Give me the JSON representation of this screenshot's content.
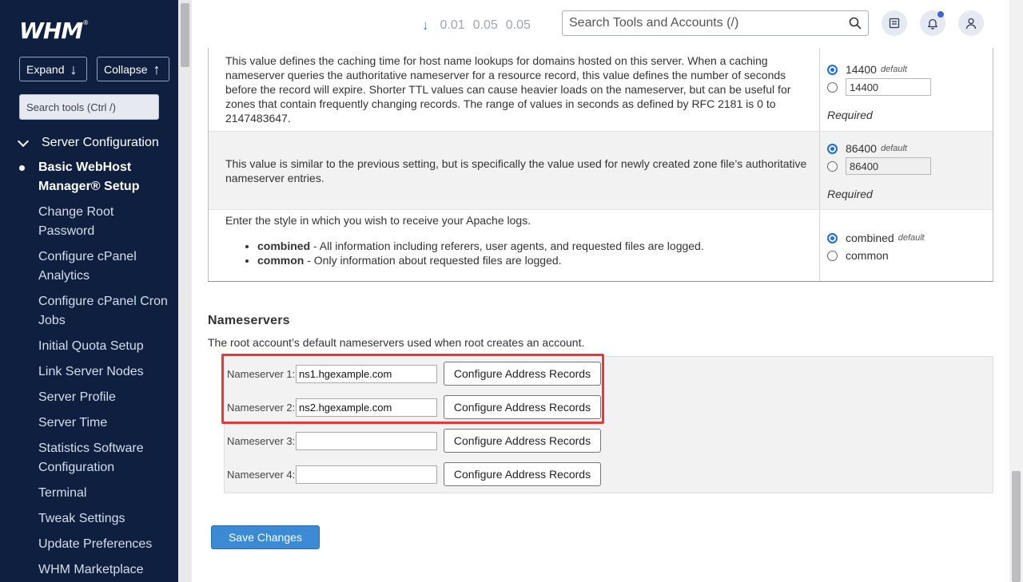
{
  "sidebar": {
    "logo": "WHM",
    "logo_mark": "®",
    "expand_label": "Expand",
    "collapse_label": "Collapse",
    "search_placeholder": "Search tools (Ctrl /)",
    "section": "Server Configuration",
    "items": [
      {
        "label": "Basic WebHost Manager® Setup",
        "active": true
      },
      {
        "label": "Change Root Password"
      },
      {
        "label": "Configure cPanel Analytics"
      },
      {
        "label": "Configure cPanel Cron Jobs"
      },
      {
        "label": "Initial Quota Setup"
      },
      {
        "label": "Link Server Nodes"
      },
      {
        "label": "Server Profile"
      },
      {
        "label": "Server Time"
      },
      {
        "label": "Statistics Software Configuration"
      },
      {
        "label": "Terminal"
      },
      {
        "label": "Tweak Settings"
      },
      {
        "label": "Update Preferences"
      },
      {
        "label": "WHM Marketplace"
      }
    ]
  },
  "topbar": {
    "load": [
      "0.01",
      "0.05",
      "0.05"
    ],
    "search_placeholder": "Search Tools and Accounts (/)"
  },
  "settings": {
    "ttl": {
      "description": "This value defines the caching time for host name lookups for domains hosted on this server. When a caching nameserver queries the authoritative nameserver for a resource record, this value defines the number of seconds before the record will expire. Shorter TTL values can cause heavier loads on the nameserver, but can be useful for zones that contain frequently changing records. The range of values in seconds as defined by RFC 2181 is 0 to 2147483647.",
      "default_value": "14400",
      "default_tag": "default",
      "custom_value": "14400",
      "required": "Required"
    },
    "ns_ttl": {
      "description": "This value is similar to the previous setting, but is specifically the value used for newly created zone file’s authoritative nameserver entries.",
      "default_value": "86400",
      "default_tag": "default",
      "custom_value": "86400",
      "required": "Required"
    },
    "apache_logs": {
      "description": "Enter the style in which you wish to receive your Apache logs.",
      "bullets": [
        {
          "term": "combined",
          "text": " - All information including referers, user agents, and requested files are logged."
        },
        {
          "term": "common",
          "text": " - Only information about requested files are logged."
        }
      ],
      "opt1": "combined",
      "opt1_tag": "default",
      "opt2": "common"
    }
  },
  "nameservers": {
    "title": "Nameservers",
    "subtitle": "The root account’s default nameservers used when root creates an account.",
    "button_label": "Configure Address Records",
    "rows": [
      {
        "label": "Nameserver 1:",
        "value": "ns1.hgexample.com"
      },
      {
        "label": "Nameserver 2:",
        "value": "ns2.hgexample.com"
      },
      {
        "label": "Nameserver 3:",
        "value": ""
      },
      {
        "label": "Nameserver 4:",
        "value": ""
      }
    ]
  },
  "save_label": "Save Changes",
  "colors": {
    "sidebar_bg": "#0e1f3f",
    "accent": "#3d8ad4",
    "highlight": "#e03b3b"
  }
}
